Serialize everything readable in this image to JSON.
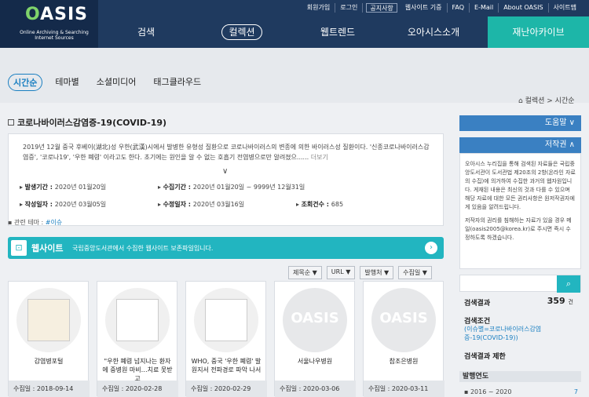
{
  "logo": {
    "mark_prefix": "O",
    "mark_rest": "ASIS",
    "sub": "Online Archiving & Searching Internet Sources"
  },
  "util": [
    "회원가입",
    "로그인",
    "공지사항",
    "웹사이트 기증",
    "FAQ",
    "E-Mail",
    "About OASIS",
    "사이트맵"
  ],
  "gnb": [
    "검색",
    "컬렉션",
    "웹트렌드",
    "오아시스소개",
    "재난아카이브"
  ],
  "tabs": [
    "시간순",
    "테마별",
    "소셜미디어",
    "태그클라우드"
  ],
  "breadcrumb": "⌂ 컬렉션 > 시간순",
  "collection": {
    "title": "코로나바이러스감염증-19(COVID-19)",
    "desc": "2019년 12월 중국 후베이(湖北)성 우한(武漢)시에서 발병한 유형성 질환으로 코로나바이러스의 변종에 의한 바이러스성 질환이다. '신종코로나바이러스감염증', '코로나19', '우한 폐렴' 이라고도 한다. 초기에는 원인을 알 수 없는 호흡기 전염병으로만 알려졌으......",
    "more": "더보기",
    "collect_period_label": "발생기간 : ",
    "collect_period": "2020년 01월20일",
    "gather_label": "수집기간 : ",
    "gather": "2020년 01월20일 ~ 9999년 12월31일",
    "created_label": "작성일자 : ",
    "created": "2020년 03월05일",
    "modified_label": "수정일자 : ",
    "modified": "2020년 03월16일",
    "views_label": "조회건수 : ",
    "views": "685",
    "theme_label": "관련 테마 : ",
    "theme": "#이슈"
  },
  "website": {
    "label": "웹사이트",
    "desc": "국립중앙도서관에서 수집한 웹사이트 보존파일입니다."
  },
  "sorts": [
    "제목순 ▼",
    "URL ▼",
    "발행처 ▼",
    "수집일 ▼"
  ],
  "cards": [
    {
      "caption": "감염병포털",
      "date": "수집일 : 2018-09-14"
    },
    {
      "caption": "\"우한 폐렴 넘지나는 환자에 중병원 마비…치료 못받고",
      "date": "수집일 : 2020-02-28"
    },
    {
      "caption": "WHO, 중국 '우한 폐렴' 발원지서 전파경로 파악 나서",
      "date": "수집일 : 2020-02-29"
    },
    {
      "caption": "서울나우병원",
      "date": "수집일 : 2020-03-06"
    },
    {
      "caption": "참조은병원",
      "date": "수집일 : 2020-03-11"
    }
  ],
  "right": {
    "help": "도움말 ∨",
    "copyright": "저작권 ∧",
    "copy_text": "오아시스 누리집을 통해 검색된 자료들은 국립중앙도서관이 도서관법 제20조의 2항(온라인 자료의 수집)에 의거하여 수집한 과거의 웹자원입니다. 게재된 내용은 최신의 것과 다를 수 있으며 해당 자료에 대한 모든 권리사항은 원저작권자에게 있음을 알려드립니다.",
    "copy_text2": "저작자의 권리를 침해하는 자료가 있을 경우 메일(oasis2005@korea.kr)로 주시면 즉시 수정하도록 하겠습니다.",
    "result_label": "검색결과",
    "count": "359",
    "count_unit": "건",
    "cond_label": "검색조건",
    "cond": "(이슈별=코로나바이러스감염증-19(COVID-19))",
    "restrict_label": "검색결과 제한",
    "year_label": "발행연도",
    "year_range": "2016 ~ 2020",
    "year_count": "7"
  }
}
